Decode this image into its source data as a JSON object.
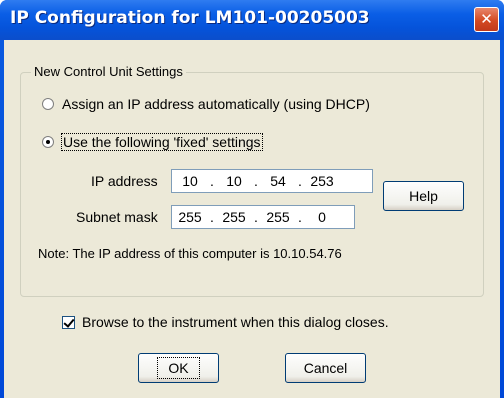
{
  "window": {
    "title": "IP Configuration for LM101-00205003",
    "close_glyph": "✕"
  },
  "groupbox": {
    "label": "New Control Unit Settings"
  },
  "options": {
    "dhcp_label": "Assign an IP address automatically (using DHCP)",
    "fixed_label": "Use the following 'fixed' settings",
    "selected": "fixed"
  },
  "fields": {
    "ip_label": "IP address",
    "ip_octets": [
      "10",
      "10",
      "54",
      "253"
    ],
    "subnet_label": "Subnet mask",
    "subnet_octets": [
      "255",
      "255",
      "255",
      "0"
    ],
    "separator": "."
  },
  "buttons": {
    "help": "Help",
    "ok": "OK",
    "cancel": "Cancel"
  },
  "note": "Note:  The IP address of this computer is 10.10.54.76",
  "browse": {
    "label": "Browse to the instrument when this dialog closes.",
    "checked": true
  },
  "colors": {
    "titlebar": "#0a5ee6",
    "close_button": "#d44a22",
    "dialog_bg": "#ece9d8",
    "button_border": "#003c74"
  }
}
